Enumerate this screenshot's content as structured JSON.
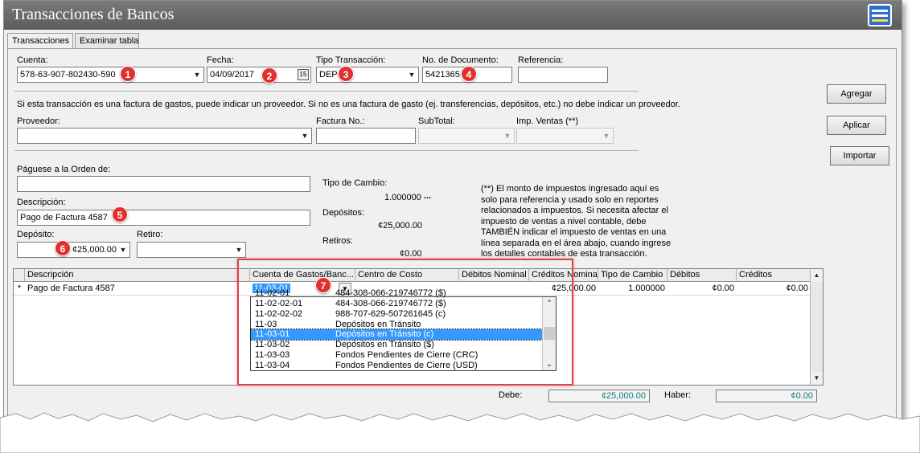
{
  "window": {
    "title": "Transacciones de Bancos",
    "icon": "calculator-app-icon"
  },
  "tabs": [
    {
      "label": "Transacciones"
    },
    {
      "label": "Examinar tabla"
    }
  ],
  "form": {
    "cuenta_label": "Cuenta:",
    "cuenta_value": "578-63-907-802430-590",
    "fecha_label": "Fecha:",
    "fecha_value": "04/09/2017",
    "fecha_btn": "15",
    "tipo_label": "Tipo Transacción:",
    "tipo_value": "DEP",
    "doc_label": "No. de Documento:",
    "doc_value": "5421365",
    "ref_label": "Referencia:",
    "ref_value": "",
    "proveedor_note": "Si esta transacción es una factura de gastos, puede indicar un proveedor. Si no es una factura de gasto (ej. transferencias, depósitos, etc.) no debe indicar un proveedor.",
    "proveedor_label": "Proveedor:",
    "factura_label": "Factura No.:",
    "subtotal_label": "SubTotal:",
    "impventas_label": "Imp. Ventas (**)",
    "paguese_label": "Páguese a la Orden de:",
    "paguese_value": "",
    "descripcion_label": "Descripción:",
    "descripcion_value": "Pago de Factura 4587",
    "deposito_label": "Depósito:",
    "deposito_value": "¢25,000.00",
    "retiro_label": "Retiro:",
    "tipo_cambio_label": "Tipo de Cambio:",
    "tipo_cambio_value": "1.000000",
    "tipo_cambio_btn": "...",
    "depositos_label": "Depósitos:",
    "depositos_value": "¢25,000.00",
    "retiros_label": "Retiros:",
    "retiros_value": "¢0.00",
    "impuestos_note": "(**) El monto de impuestos ingresado aquí es solo para referencia y usado solo en reportes relacionados a impuestos. Si necesita afectar el impuesto de ventas a nivel contable, debe TAMBIÉN indicar el impuesto de ventas en una línea separada en el área abajo, cuando ingrese los detalles contables de esta transacción."
  },
  "buttons": {
    "agregar": "Agregar",
    "aplicar": "Aplicar",
    "importar": "Importar"
  },
  "grid": {
    "columns": [
      "Descripción",
      "Cuenta de Gastos/Banc...",
      "Centro de Costo",
      "Débitos Nominal",
      "Créditos Nominal",
      "Tipo de Cambio",
      "Débitos",
      "Créditos"
    ],
    "row_marker": "*",
    "row": {
      "descripcion": "Pago de Factura 4587",
      "cuenta": "11-03-01",
      "centro": "",
      "debitos_nominal": "",
      "creditos_nominal": "¢25,000.00",
      "tipo_cambio": "1.000000",
      "debitos": "¢0.00",
      "creditos": "¢0.00"
    }
  },
  "dropdown_items": [
    {
      "code": "11-02-01",
      "desc": "484-308-066-219746772 ($)"
    },
    {
      "code": "11-02-02-01",
      "desc": "484-308-066-219746772 ($)"
    },
    {
      "code": "11-02-02-02",
      "desc": "988-707-629-507261645 (c)"
    },
    {
      "code": "11-03",
      "desc": "Depósitos en Tránsito"
    },
    {
      "code": "11-03-01",
      "desc": "Depósitos en Tránsito (c)"
    },
    {
      "code": "11-03-02",
      "desc": "Depósitos en Tránsito ($)"
    },
    {
      "code": "11-03-03",
      "desc": "Fondos Pendientes de Cierre (CRC)"
    },
    {
      "code": "11-03-04",
      "desc": "Fondos Pendientes de Cierre (USD)"
    }
  ],
  "totals": {
    "debe_label": "Debe:",
    "debe_value": "¢25,000.00",
    "haber_label": "Haber:",
    "haber_value": "¢0.00"
  },
  "badges": [
    "1",
    "2",
    "3",
    "4",
    "5",
    "6",
    "7"
  ],
  "colors": {
    "badge": "#e3302f",
    "highlight": "#3399ff",
    "titlebar": "#6a6a6a",
    "total_text": "#0a7b7b"
  }
}
